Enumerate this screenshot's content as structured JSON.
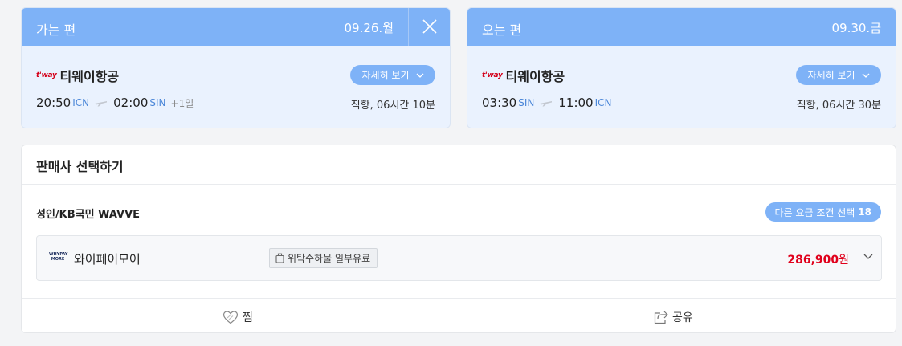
{
  "outbound": {
    "label": "가는 편",
    "date": "09.26.월",
    "airline": "티웨이항공",
    "airline_logo_text": "t'way",
    "detail_label": "자세히 보기",
    "dep_time": "20:50",
    "dep_code": "ICN",
    "arr_time": "02:00",
    "arr_code": "SIN",
    "day_offset": "+1일",
    "duration": "직항, 06시간 10분"
  },
  "inbound": {
    "label": "오는 편",
    "date": "09.30.금",
    "airline": "티웨이항공",
    "airline_logo_text": "t'way",
    "detail_label": "자세히 보기",
    "dep_time": "03:30",
    "dep_code": "SIN",
    "arr_time": "11:00",
    "arr_code": "ICN",
    "duration": "직항, 06시간 30분"
  },
  "seller_panel": {
    "title": "판매사 선택하기",
    "fare_condition": "성인/KB국민 WAVVE",
    "other_fares_label": "다른 요금 조건 선택",
    "other_fares_count": "18",
    "seller": {
      "logo_line1": "WHYPAY",
      "logo_line2": "MORE",
      "name": "와이페이모어",
      "baggage_tag": "위탁수하물 일부유료",
      "price": "286,900",
      "currency": "원"
    },
    "like_label": "찜",
    "share_label": "공유"
  },
  "colors": {
    "header_blue": "#7eb2f7",
    "card_bg": "#eaf2fe",
    "price_red": "#e0001b",
    "code_blue": "#4a86d8"
  }
}
